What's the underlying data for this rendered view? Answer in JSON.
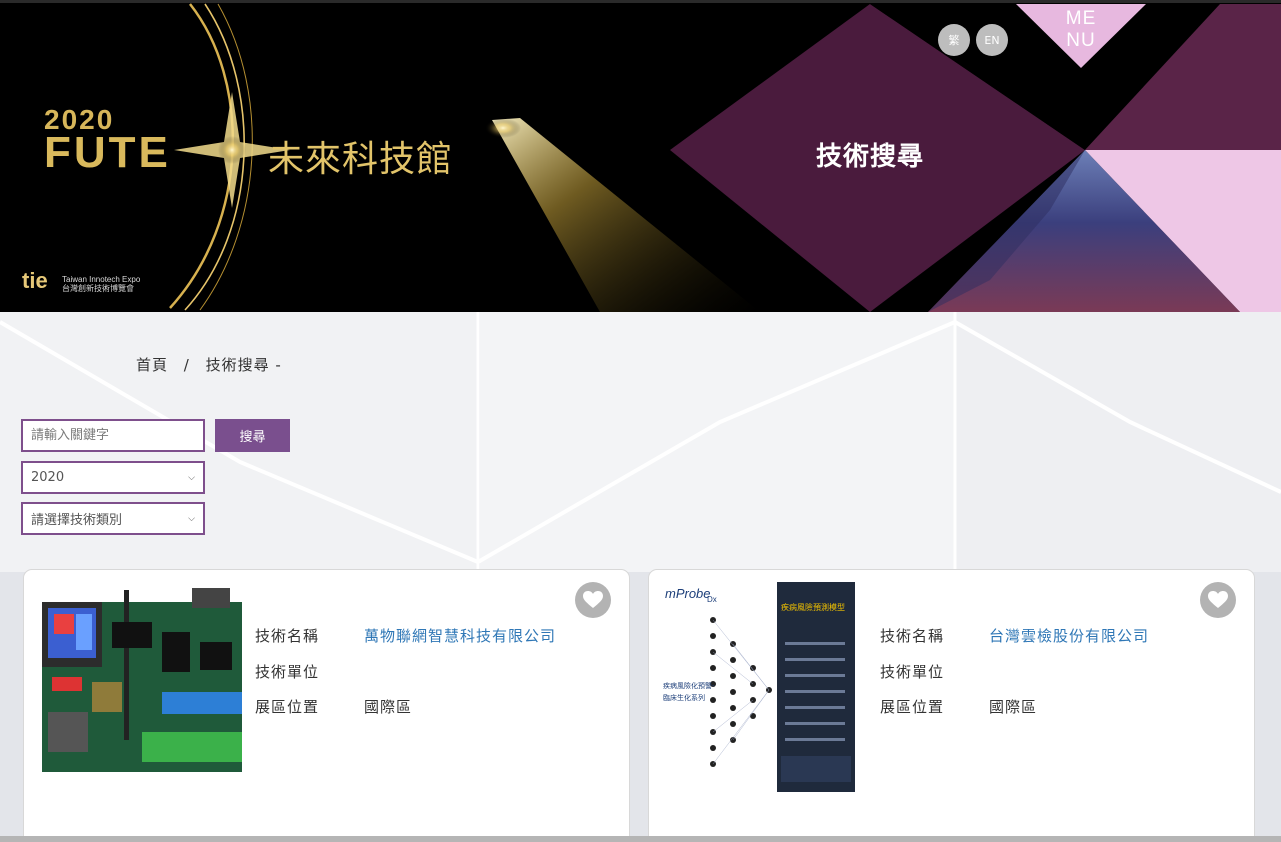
{
  "header": {
    "logo_year": "2020",
    "logo_fute": "FUTE",
    "logo_cn": "未來科技館",
    "tie_mark": "tie",
    "tie_name": "Taiwan Innotech Expo",
    "tie_sub": "台灣創新技術博覽會",
    "page_title": "技術搜尋",
    "lang_zh": "繁",
    "lang_en": "EN",
    "menu_label": "MENU",
    "menu_line1": "ME",
    "menu_line2": "NU"
  },
  "breadcrumb": {
    "home": "首頁",
    "separator": "/",
    "current": "技術搜尋 -"
  },
  "search": {
    "placeholder": "請輸入關鍵字",
    "button": "搜尋",
    "year_selected": "2020",
    "category_selected": "請選擇技術類別"
  },
  "cards": [
    {
      "name_label": "技術名稱",
      "unit_label": "技術單位",
      "location_label": "展區位置",
      "name_value": "萬物聯網智慧科技有限公司",
      "unit_value": "",
      "location_value": "國際區",
      "image_icon": "circuit-board-image",
      "favorite_icon": "heart-icon"
    },
    {
      "name_label": "技術名稱",
      "unit_label": "技術單位",
      "location_label": "展區位置",
      "name_value": "台灣雲檢股份有限公司",
      "unit_value": "",
      "location_value": "國際區",
      "image_icon": "mprobe-neural-network-image",
      "image_brand": "mProbe",
      "image_brand_sub": "Dx",
      "image_heading": "疾病風險預測模型",
      "image_side_text_1": "疾病風險化預警-",
      "image_side_text_2": "臨床生化系列",
      "favorite_icon": "heart-icon"
    }
  ],
  "colors": {
    "accent_purple": "#7a4f8e",
    "link_blue": "#2f77b6",
    "banner_gold": "#d9b95c"
  }
}
